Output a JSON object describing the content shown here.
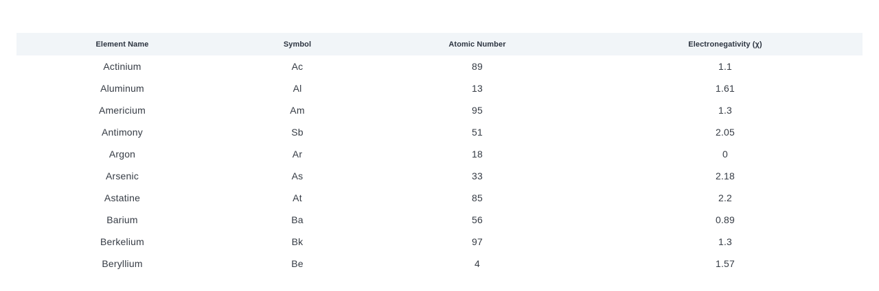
{
  "table": {
    "headers": {
      "name": "Element Name",
      "symbol": "Symbol",
      "atomic_number": "Atomic Number",
      "electronegativity": "Electronegativity (χ)"
    },
    "rows": [
      {
        "name": "Actinium",
        "symbol": "Ac",
        "atomic_number": "89",
        "electronegativity": "1.1"
      },
      {
        "name": "Aluminum",
        "symbol": "Al",
        "atomic_number": "13",
        "electronegativity": "1.61"
      },
      {
        "name": "Americium",
        "symbol": "Am",
        "atomic_number": "95",
        "electronegativity": "1.3"
      },
      {
        "name": "Antimony",
        "symbol": "Sb",
        "atomic_number": "51",
        "electronegativity": "2.05"
      },
      {
        "name": "Argon",
        "symbol": "Ar",
        "atomic_number": "18",
        "electronegativity": "0"
      },
      {
        "name": "Arsenic",
        "symbol": "As",
        "atomic_number": "33",
        "electronegativity": "2.18"
      },
      {
        "name": "Astatine",
        "symbol": "At",
        "atomic_number": "85",
        "electronegativity": "2.2"
      },
      {
        "name": "Barium",
        "symbol": "Ba",
        "atomic_number": "56",
        "electronegativity": "0.89"
      },
      {
        "name": "Berkelium",
        "symbol": "Bk",
        "atomic_number": "97",
        "electronegativity": "1.3"
      },
      {
        "name": "Beryllium",
        "symbol": "Be",
        "atomic_number": "4",
        "electronegativity": "1.57"
      }
    ]
  }
}
